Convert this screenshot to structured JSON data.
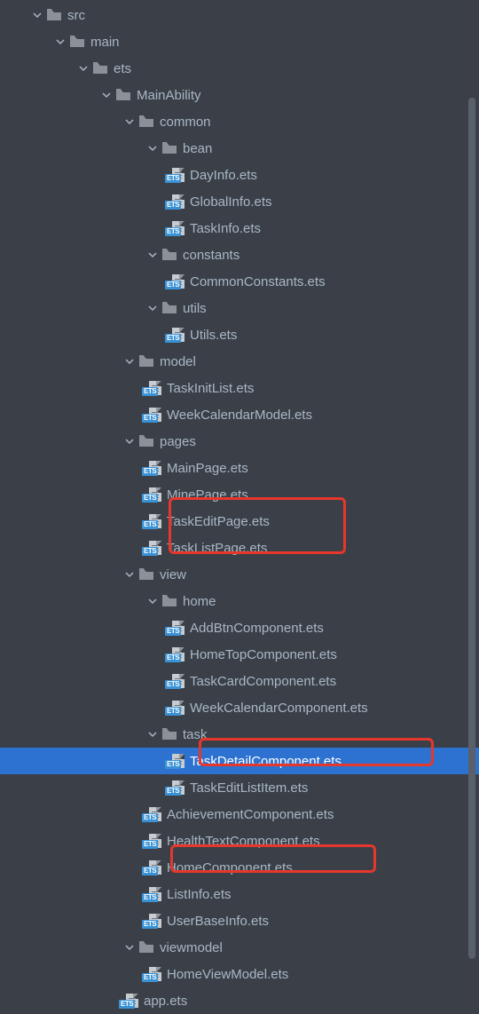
{
  "ets_badge": "ETS",
  "tree": [
    {
      "depth": 0,
      "kind": "folder",
      "expanded": true,
      "label": "src"
    },
    {
      "depth": 1,
      "kind": "folder",
      "expanded": true,
      "label": "main"
    },
    {
      "depth": 2,
      "kind": "folder",
      "expanded": true,
      "label": "ets"
    },
    {
      "depth": 3,
      "kind": "folder",
      "expanded": true,
      "label": "MainAbility"
    },
    {
      "depth": 4,
      "kind": "folder",
      "expanded": true,
      "label": "common"
    },
    {
      "depth": 5,
      "kind": "folder",
      "expanded": true,
      "label": "bean"
    },
    {
      "depth": 6,
      "kind": "file",
      "label": "DayInfo.ets"
    },
    {
      "depth": 6,
      "kind": "file",
      "label": "GlobalInfo.ets"
    },
    {
      "depth": 6,
      "kind": "file",
      "label": "TaskInfo.ets"
    },
    {
      "depth": 5,
      "kind": "folder",
      "expanded": true,
      "label": "constants"
    },
    {
      "depth": 6,
      "kind": "file",
      "label": "CommonConstants.ets"
    },
    {
      "depth": 5,
      "kind": "folder",
      "expanded": true,
      "label": "utils"
    },
    {
      "depth": 6,
      "kind": "file",
      "label": "Utils.ets"
    },
    {
      "depth": 4,
      "kind": "folder",
      "expanded": true,
      "label": "model"
    },
    {
      "depth": 5,
      "kind": "file",
      "label": "TaskInitList.ets"
    },
    {
      "depth": 5,
      "kind": "file",
      "label": "WeekCalendarModel.ets"
    },
    {
      "depth": 4,
      "kind": "folder",
      "expanded": true,
      "label": "pages"
    },
    {
      "depth": 5,
      "kind": "file",
      "label": "MainPage.ets"
    },
    {
      "depth": 5,
      "kind": "file",
      "label": "MinePage.ets"
    },
    {
      "depth": 5,
      "kind": "file",
      "label": "TaskEditPage.ets"
    },
    {
      "depth": 5,
      "kind": "file",
      "label": "TaskListPage.ets"
    },
    {
      "depth": 4,
      "kind": "folder",
      "expanded": true,
      "label": "view"
    },
    {
      "depth": 5,
      "kind": "folder",
      "expanded": true,
      "label": "home"
    },
    {
      "depth": 6,
      "kind": "file",
      "label": "AddBtnComponent.ets"
    },
    {
      "depth": 6,
      "kind": "file",
      "label": "HomeTopComponent.ets"
    },
    {
      "depth": 6,
      "kind": "file",
      "label": "TaskCardComponent.ets"
    },
    {
      "depth": 6,
      "kind": "file",
      "label": "WeekCalendarComponent.ets"
    },
    {
      "depth": 5,
      "kind": "folder",
      "expanded": true,
      "label": "task"
    },
    {
      "depth": 6,
      "kind": "file",
      "label": "TaskDetailComponent.ets",
      "selected": true
    },
    {
      "depth": 6,
      "kind": "file",
      "label": "TaskEditListItem.ets"
    },
    {
      "depth": 5,
      "kind": "file",
      "label": "AchievementComponent.ets"
    },
    {
      "depth": 5,
      "kind": "file",
      "label": "HealthTextComponent.ets"
    },
    {
      "depth": 5,
      "kind": "file",
      "label": "HomeComponent.ets"
    },
    {
      "depth": 5,
      "kind": "file",
      "label": "ListInfo.ets"
    },
    {
      "depth": 5,
      "kind": "file",
      "label": "UserBaseInfo.ets"
    },
    {
      "depth": 4,
      "kind": "folder",
      "expanded": true,
      "label": "viewmodel"
    },
    {
      "depth": 5,
      "kind": "file",
      "label": "HomeViewModel.ets"
    },
    {
      "depth": 4,
      "kind": "file",
      "label": "app.ets"
    }
  ],
  "highlighted_files": [
    "TaskEditPage.ets",
    "TaskListPage.ets",
    "TaskDetailComponent.ets",
    "HomeComponent.ets"
  ]
}
